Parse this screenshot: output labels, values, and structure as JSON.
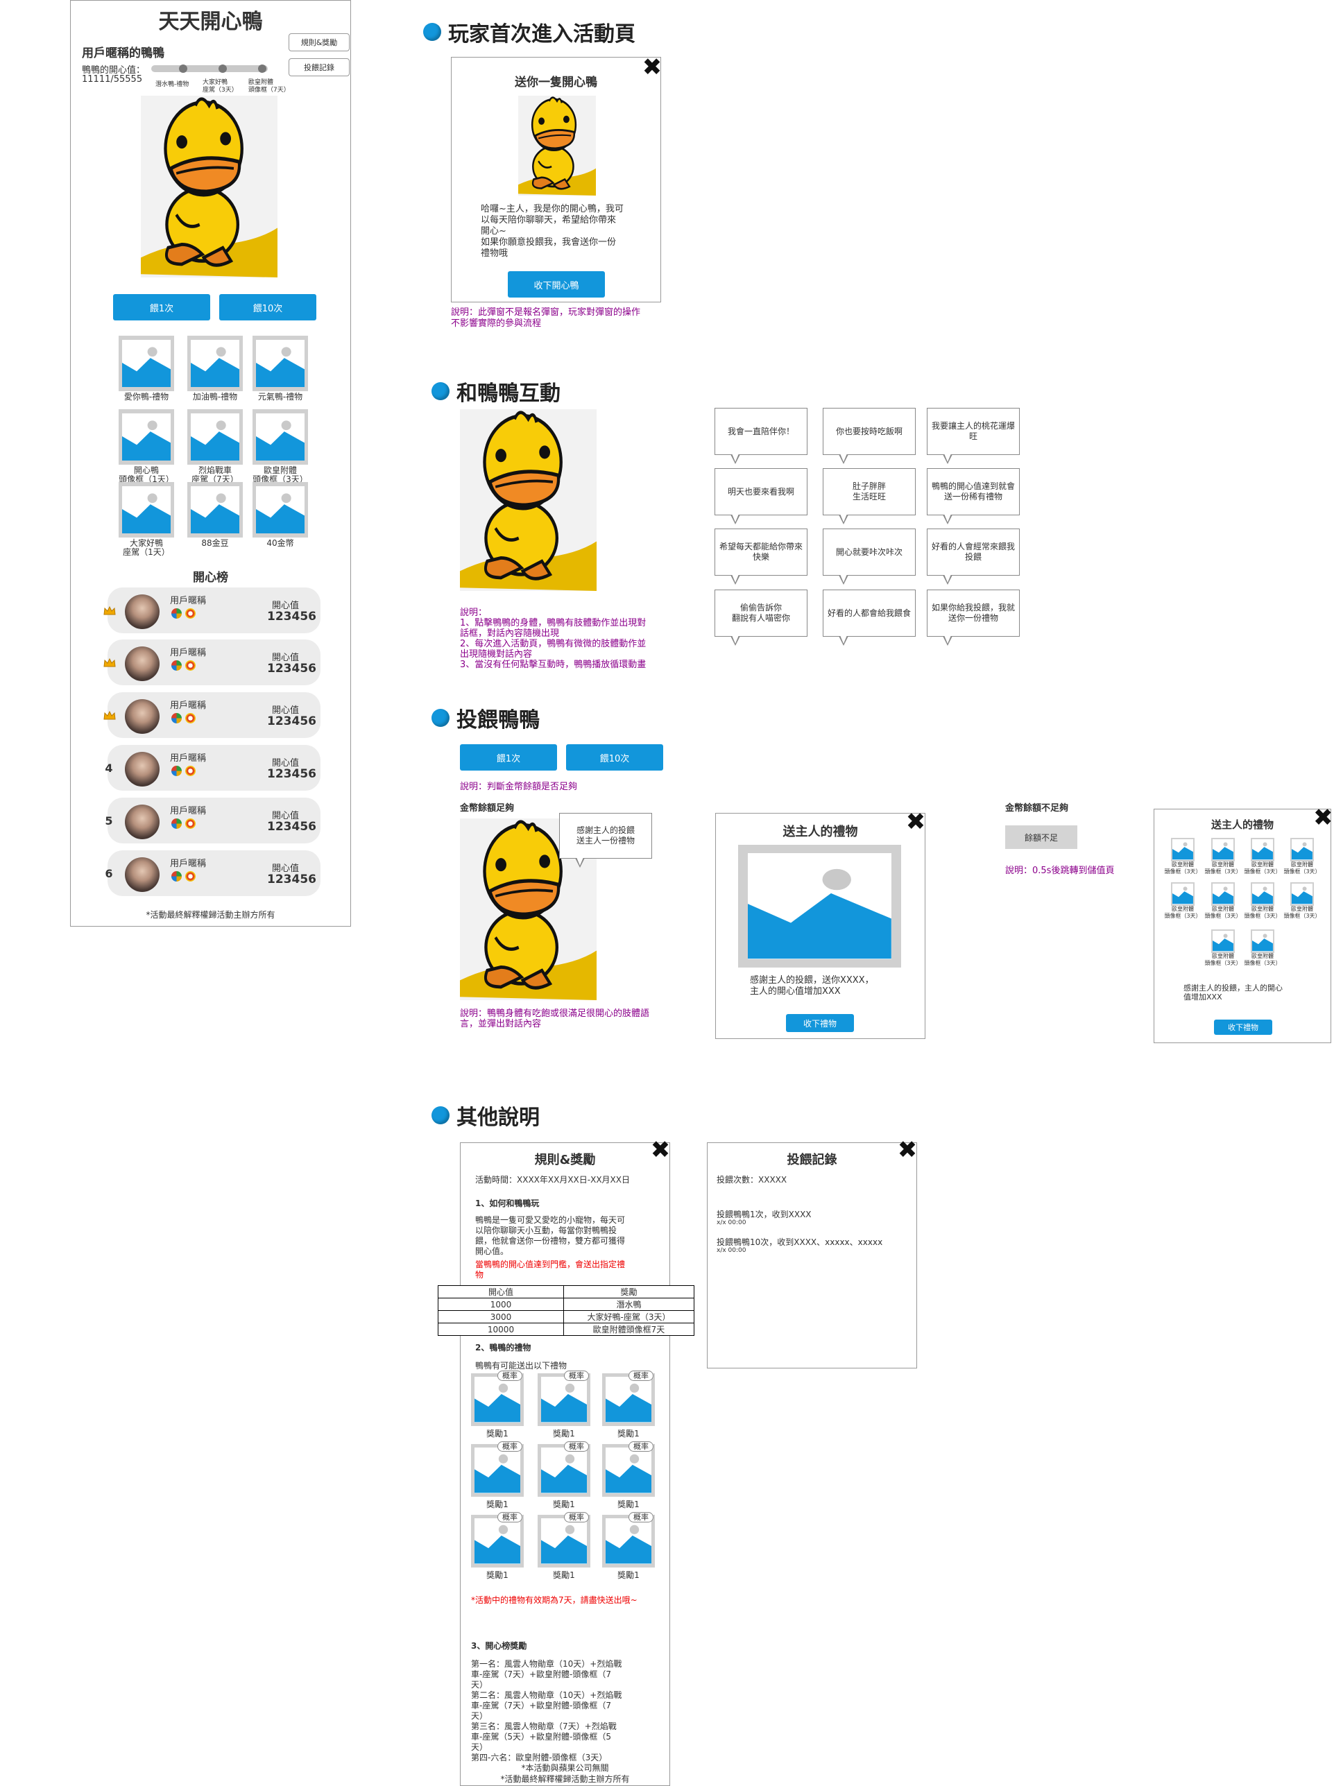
{
  "main": {
    "title": "天天開心鴨",
    "user_title": "用戶暱稱的鴨鴨",
    "happy_label": "鴨鴨的開心值：",
    "happy_value": "11111/55555",
    "rules_btn": "規則&獎勵",
    "record_btn": "投餵記錄",
    "milestones": [
      "潛水鴨-禮物",
      "大家好鴨\n座駕（3天）",
      "歐皇附體\n頭像框（7天）"
    ],
    "feed1": "餵1次",
    "feed10": "餵10次",
    "gifts": [
      "愛你鴨-禮物",
      "加油鴨-禮物",
      "元氣鴨-禮物",
      "開心鴨\n頭像框（1天）",
      "烈焰戰車\n座駕（7天）",
      "歐皇附體\n頭像框（3天）",
      "大家好鴨\n座駕（1天）",
      "88金豆",
      "40金幣"
    ],
    "leaderboard_title": "開心榜",
    "ranks": [
      {
        "rank": "",
        "name": "用戶暱稱",
        "label": "開心值",
        "value": "123456"
      },
      {
        "rank": "",
        "name": "用戶暱稱",
        "label": "開心值",
        "value": "123456"
      },
      {
        "rank": "",
        "name": "用戶暱稱",
        "label": "開心值",
        "value": "123456"
      },
      {
        "rank": "4",
        "name": "用戶暱稱",
        "label": "開心值",
        "value": "123456"
      },
      {
        "rank": "5",
        "name": "用戶暱稱",
        "label": "開心值",
        "value": "123456"
      },
      {
        "rank": "6",
        "name": "用戶暱稱",
        "label": "開心值",
        "value": "123456"
      }
    ],
    "footer": "*活動最終解釋權歸活動主辦方所有"
  },
  "s1": {
    "title": "玩家首次進入活動頁",
    "popup_title": "送你一隻開心鴨",
    "popup_text": "哈囉~主人，我是你的開心鴨，我可\n以每天陪你聊聊天，希望給你帶來\n開心~\n如果你願意投餵我，我會送你一份\n禮物哦",
    "popup_btn": "收下開心鴨",
    "note": "說明：此彈窗不是報名彈窗，玩家對彈窗的操作\n不影響實際的參與流程"
  },
  "s2": {
    "title": "和鴨鴨互動",
    "note": "說明：\n1、點擊鴨鴨的身體，鴨鴨有肢體動作並出現對\n話框，對話內容隨機出現\n2、每次進入活動頁，鴨鴨有微微的肢體動作並\n出現隨機對話內容\n3、當沒有任何點擊互動時，鴨鴨播放循環動畫",
    "bubbles": [
      "我會一直陪伴你！",
      "你也要按時吃飯啊",
      "我要讓主人的桃花運爆\n旺",
      "明天也要來看我啊",
      "肚子胖胖\n生活旺旺",
      "鴨鴨的開心值達到就會\n送一份稀有禮物",
      "希望每天都能給你帶來\n快樂",
      "開心就要咔次咔次",
      "好看的人會經常來餵我\n投餵",
      "偷偷告訴你\n翻說有人喵密你",
      "好看的人都會給我餵食",
      "如果你給我投餵，我就\n送你一份禮物"
    ]
  },
  "s3": {
    "title": "投餵鴨鴨",
    "feed1": "餵1次",
    "feed10": "餵10次",
    "note_check": "說明：判斷金幣餘額是否足夠",
    "enough_label": "金幣餘額足夠",
    "bubble": "感謝主人的投餵\n送主人一份禮物",
    "note_anim": "說明：鴨鴨身體有吃飽或很滿足很開心的肢體語\n言，並彈出對話內容",
    "gift_popup_title": "送主人的禮物",
    "gift_popup_text": "感謝主人的投餵，送你XXXX，\n主人的開心值增加XXX",
    "gift_popup_btn": "收下禮物",
    "insufficient_label": "金幣餘額不足夠",
    "insufficient_btn": "餘額不足",
    "insufficient_note": "說明：0.5s後跳轉到儲值頁",
    "multi_title": "送主人的禮物",
    "multi_items": [
      "歐皇附體\n頭像框（3天）",
      "歐皇附體\n頭像框（3天）",
      "歐皇附體\n頭像框（3天）",
      "歐皇附體\n頭像框（3天）",
      "歐皇附體\n頭像框（3天）",
      "歐皇附體\n頭像框（3天）",
      "歐皇附體\n頭像框（3天）",
      "歐皇附體\n頭像框（3天）",
      "歐皇附體\n頭像框（3天）",
      "歐皇附體\n頭像框（3天）"
    ],
    "multi_text": "感謝主人的投餵，主人的開心\n值增加XXX",
    "multi_btn": "收下禮物"
  },
  "s4": {
    "title": "其他說明",
    "rules_title": "規則&獎勵",
    "period": "活動時間：XXXX年XX月XX日-XX月XX日",
    "h1": "1、如何和鴨鴨玩",
    "p1": "鴨鴨是一隻可愛又愛吃的小寵物，每天可\n以陪你聊聊天小互動，每當你對鴨鴨投\n餵，他就會送你一份禮物，雙方都可獲得\n開心值。",
    "p1_red": "當鴨鴨的開心值達到門檻，會送出指定禮\n物",
    "table_head": [
      "開心值",
      "獎勵"
    ],
    "table_rows": [
      [
        "1000",
        "潛水鴨"
      ],
      [
        "3000",
        "大家好鴨-座駕（3天）"
      ],
      [
        "10000",
        "歐皇附體頭像框7天"
      ]
    ],
    "h2": "2、鴨鴨的禮物",
    "p2": "鴨鴨有可能送出以下禮物",
    "prob": "概率",
    "reward": "獎勵1",
    "red2": "*活動中的禮物有效期為7天，請盡快送出哦~",
    "h3": "3、開心榜獎勵",
    "p3": "第一名：風雲人物勛章（10天）+烈焰戰\n車-座駕（7天）+歐皇附體-頭像框（7\n天）\n第二名：風雲人物勛章（10天）+烈焰戰\n車-座駕（7天）+歐皇附體-頭像框（7\n天）\n第三名：風雲人物勛章（7天）+烈焰戰\n車-座駕（5天）+歐皇附體-頭像框（5\n天）\n第四-六名：歐皇附體-頭像框（3天）",
    "foot1": "*本活動與蘋果公司無關",
    "foot2": "*活動最終解釋權歸活動主辦方所有",
    "record_title": "投餵記錄",
    "record_count": "投餵次數：XXXXX",
    "record1": "投餵鴨鴨1次，收到XXXX",
    "record1_time": "x/x  00:00",
    "record2": "投餵鴨鴨10次，收到XXXX、xxxxx、xxxxx",
    "record2_time": "x/x  00:00"
  },
  "colors": {
    "accent": "#1296db",
    "purple": "#8b008b",
    "red": "#ee0000",
    "duck": "#f6c800"
  }
}
